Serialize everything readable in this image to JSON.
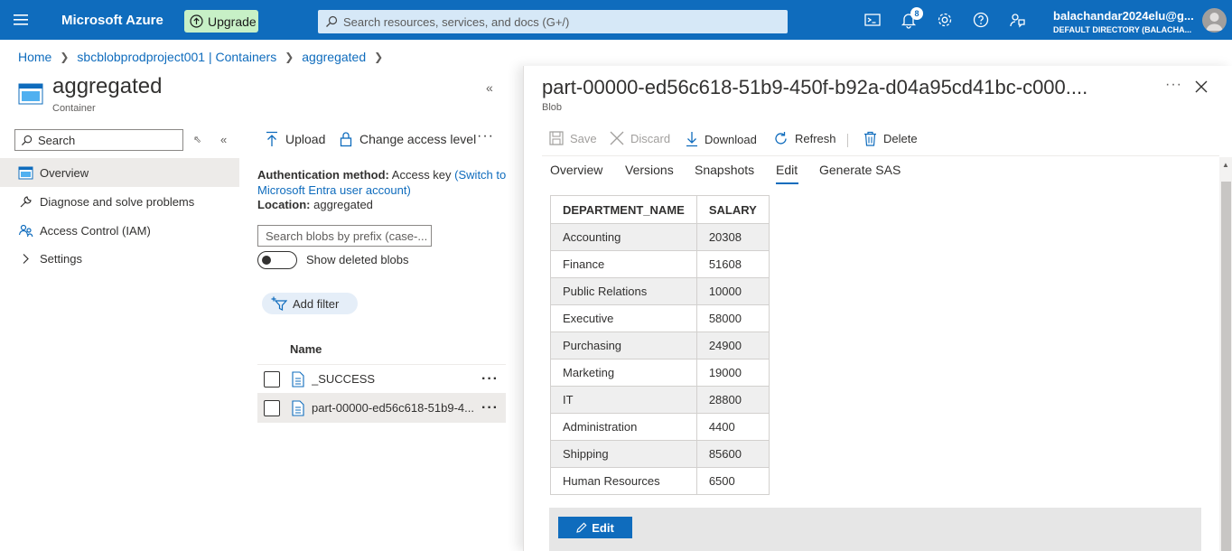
{
  "topbar": {
    "brand": "Microsoft Azure",
    "upgrade_label": "Upgrade",
    "search_placeholder": "Search resources, services, and docs (G+/)",
    "notification_count": "8",
    "account_name": "balachandar2024elu@g...",
    "account_directory": "DEFAULT DIRECTORY (BALACHA..."
  },
  "breadcrumb": {
    "items": [
      "Home",
      "sbcblobprodproject001 | Containers",
      "aggregated"
    ]
  },
  "container": {
    "title": "aggregated",
    "subtitle": "Container"
  },
  "nav": {
    "search_placeholder": "Search",
    "items": [
      {
        "label": "Overview",
        "icon": "container-icon"
      },
      {
        "label": "Diagnose and solve problems",
        "icon": "wrench-icon"
      },
      {
        "label": "Access Control (IAM)",
        "icon": "people-icon"
      },
      {
        "label": "Settings",
        "icon": "chevron-right-icon"
      }
    ]
  },
  "middle": {
    "upload_label": "Upload",
    "access_label": "Change access level",
    "auth_label": "Authentication method:",
    "auth_value": "Access key",
    "auth_link": "(Switch to Microsoft Entra user account)",
    "location_label": "Location:",
    "location_value": "aggregated",
    "blob_search_placeholder": "Search blobs by prefix (case-...",
    "show_deleted_label": "Show deleted blobs",
    "add_filter_label": "Add filter",
    "list_header": "Name",
    "blobs": [
      "_SUCCESS",
      "part-00000-ed56c618-51b9-4..."
    ]
  },
  "blade": {
    "title": "part-00000-ed56c618-51b9-450f-b92a-d04a95cd41bc-c000....",
    "subtitle": "Blob",
    "commands": {
      "save": "Save",
      "discard": "Discard",
      "download": "Download",
      "refresh": "Refresh",
      "delete": "Delete"
    },
    "tabs": [
      "Overview",
      "Versions",
      "Snapshots",
      "Edit",
      "Generate SAS"
    ],
    "active_tab": "Edit",
    "edit_button": "Edit"
  },
  "table": {
    "headers": [
      "DEPARTMENT_NAME",
      "SALARY"
    ],
    "rows": [
      [
        "Accounting",
        "20308"
      ],
      [
        "Finance",
        "51608"
      ],
      [
        "Public Relations",
        "10000"
      ],
      [
        "Executive",
        "58000"
      ],
      [
        "Purchasing",
        "24900"
      ],
      [
        "Marketing",
        "19000"
      ],
      [
        "IT",
        "28800"
      ],
      [
        "Administration",
        "4400"
      ],
      [
        "Shipping",
        "85600"
      ],
      [
        "Human Resources",
        "6500"
      ]
    ]
  },
  "colors": {
    "azure_blue": "#0f6cbd",
    "upgrade_green": "#c7f0c6",
    "selected_row": "#edebe9"
  }
}
